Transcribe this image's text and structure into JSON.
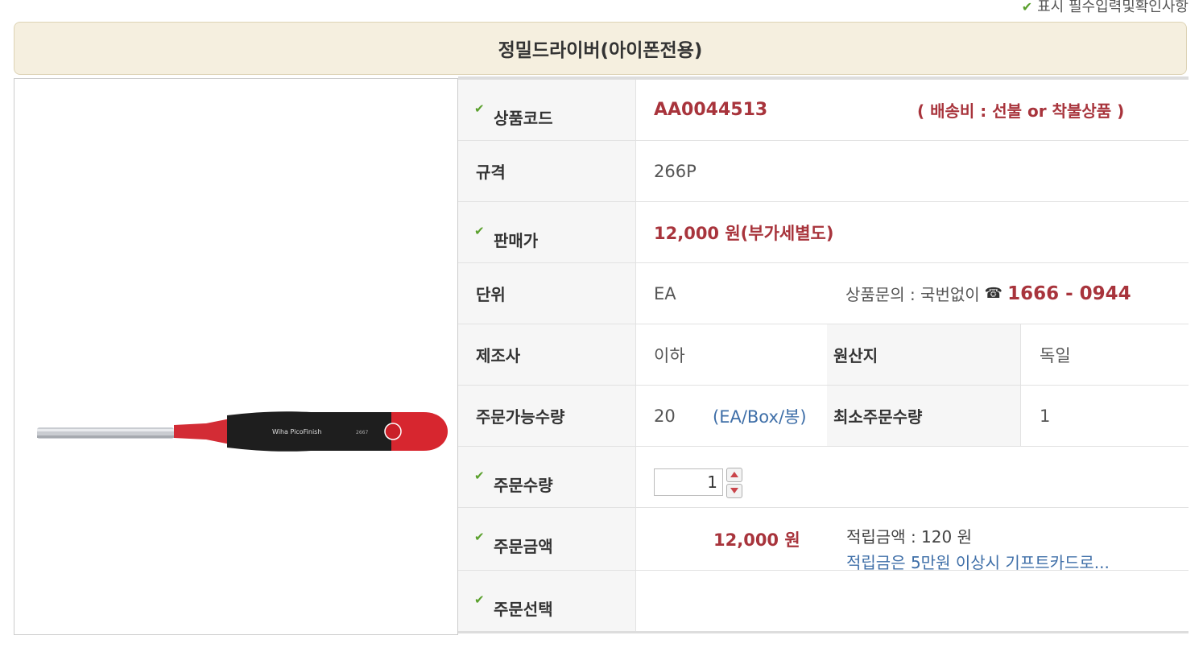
{
  "legend": {
    "check": "✔",
    "text": "표시 필수입력및확인사항"
  },
  "title": "정밀드라이버(아이폰전용)",
  "product_image": {
    "alt": "Wiha PicoFinish screwdriver",
    "handle_text": "Wiha PicoFinish",
    "handle_code": "2667"
  },
  "rows": {
    "code": {
      "label": "상품코드",
      "value": "AA0044513",
      "shipping": "( 배송비 : 선불 or 착불상품 )"
    },
    "spec": {
      "label": "규격",
      "value": "266P"
    },
    "price": {
      "label": "판매가",
      "value": "12,000 원(부가세별도)"
    },
    "unit": {
      "label": "단위",
      "value": "EA",
      "inquiry_label": "상품문의 : 국번없이",
      "phone_icon": "☎",
      "phone": "1666 - 0944"
    },
    "maker": {
      "label": "제조사",
      "value": "이하",
      "origin_label": "원산지",
      "origin_value": "독일"
    },
    "avail": {
      "label": "주문가능수량",
      "value": "20",
      "unit": "(EA/Box/봉)",
      "min_label": "최소주문수량",
      "min_value": "1"
    },
    "order_qty": {
      "label": "주문수량",
      "value": "1"
    },
    "order_amount": {
      "label": "주문금액",
      "value": "12,000 원",
      "points_label": "적립금액 : 120 원",
      "points_note": "적립금은 5만원 이상시 기프트카드로..."
    },
    "order_option": {
      "label": "주문선택",
      "value": ""
    }
  }
}
